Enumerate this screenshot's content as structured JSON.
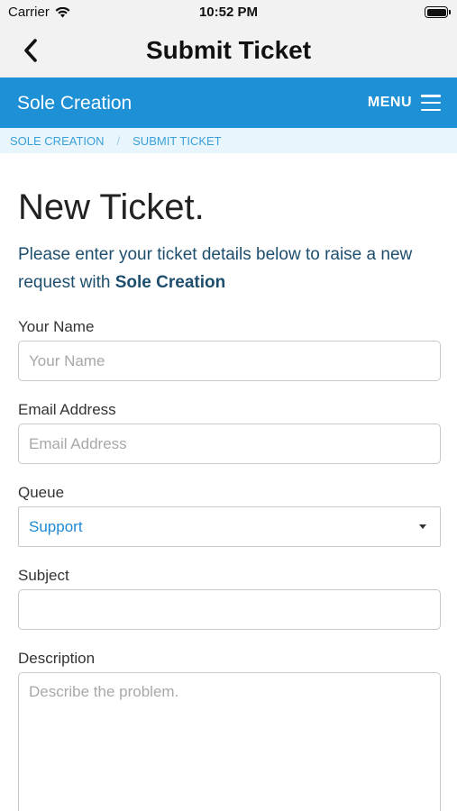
{
  "status_bar": {
    "carrier": "Carrier",
    "time": "10:52 PM",
    "wifi_icon": "wifi-icon",
    "battery_icon": "battery-icon"
  },
  "nav": {
    "title": "Submit Ticket",
    "back_icon": "chevron-left-icon"
  },
  "header": {
    "brand": "Sole Creation",
    "menu_label": "MENU",
    "menu_icon": "hamburger-icon",
    "color": "#1e90d6"
  },
  "breadcrumb": {
    "items": [
      "SOLE CREATION",
      "SUBMIT TICKET"
    ],
    "separator": "/"
  },
  "page": {
    "heading": "New Ticket.",
    "intro_text": "Please enter your ticket details below to raise a new request with ",
    "intro_company": "Sole Creation"
  },
  "form": {
    "name": {
      "label": "Your Name",
      "placeholder": "Your Name",
      "value": ""
    },
    "email": {
      "label": "Email Address",
      "placeholder": "Email Address",
      "value": ""
    },
    "queue": {
      "label": "Queue",
      "selected": "Support"
    },
    "subject": {
      "label": "Subject",
      "placeholder": "",
      "value": ""
    },
    "description": {
      "label": "Description",
      "placeholder": "Describe the problem.",
      "value": ""
    }
  }
}
